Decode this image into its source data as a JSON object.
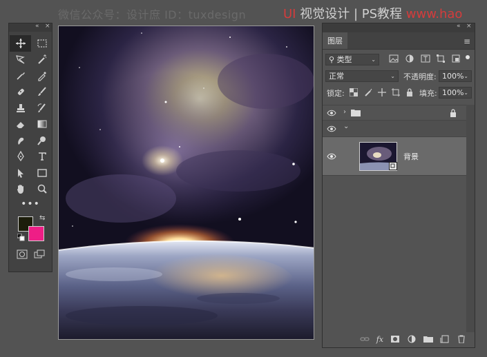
{
  "watermark_left": "微信公众号：设计庶 ID：tuxdesign",
  "watermark_right": {
    "prefix": "UI",
    "mid": "视觉设计 | PS教程",
    "url": "www.hao"
  },
  "toolbox": {
    "collapse_icon": "«",
    "close_icon": "×",
    "tools": [
      "move-tool",
      "marquee-tool",
      "lasso-tool",
      "magic-wand-tool",
      "eyedropper-tool",
      "pen-brush-tool",
      "healing-brush-tool",
      "brush-tool",
      "stamp-tool",
      "history-brush-tool",
      "eraser-tool",
      "gradient-tool",
      "smudge-tool",
      "dodge-tool",
      "pen-tool",
      "type-tool",
      "path-selection-tool",
      "rectangle-tool",
      "hand-tool",
      "zoom-tool"
    ],
    "more": "•••",
    "fg_color": "#1c1d0b",
    "bg_color": "#ee1e86"
  },
  "layers_panel": {
    "collapse_icon": "«",
    "close_icon": "×",
    "tab": "图层",
    "menu_icon": "≡",
    "filter_kind": "类型",
    "blend_mode": "正常",
    "opacity_label": "不透明度:",
    "opacity_value": "100%",
    "lock_label": "锁定:",
    "fill_label": "填充:",
    "fill_value": "100%",
    "layer_name": "背景"
  }
}
